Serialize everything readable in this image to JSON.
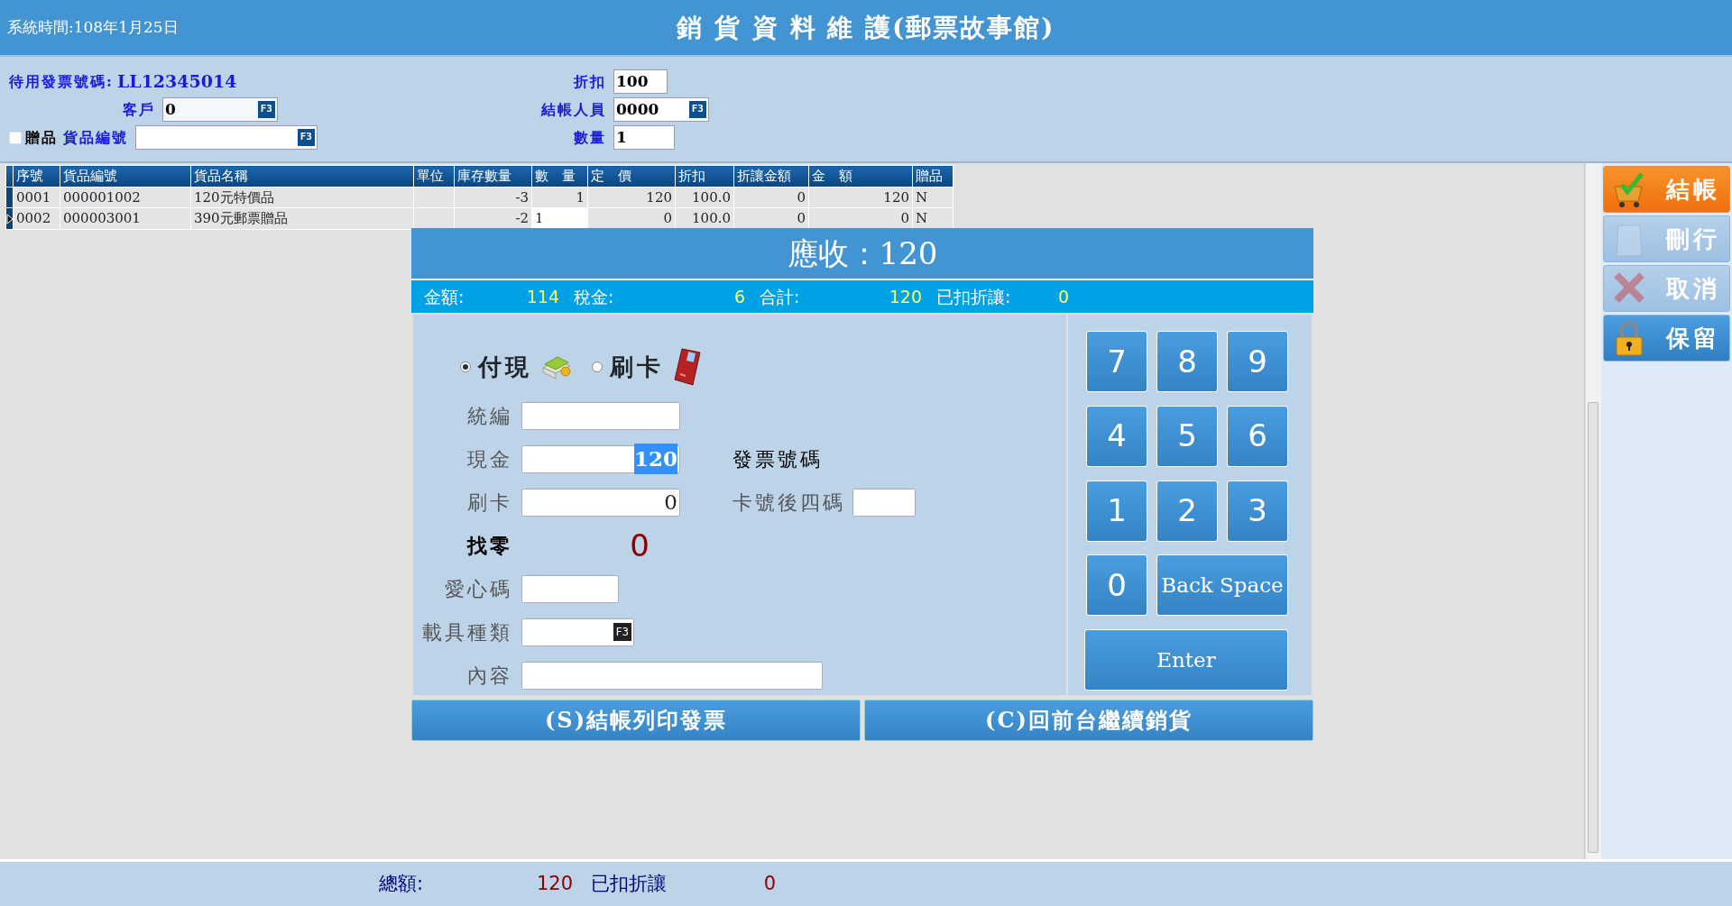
{
  "header": {
    "system_time": "系統時間:108年1月25日",
    "title": "銷 貨 資 料 維 護(郵票故事館)"
  },
  "form": {
    "invoice_label": "待用發票號碼:",
    "invoice_number": "LL12345014",
    "customer": {
      "label": "客戶",
      "value": "0",
      "key": "F3"
    },
    "gift": {
      "label": "贈品",
      "checked": false
    },
    "product_code": {
      "label": "貨品編號",
      "key": "F3"
    },
    "discount": {
      "label": "折扣",
      "value": "100"
    },
    "cashier": {
      "label": "結帳人員",
      "value": "0000",
      "key": "F3"
    },
    "quantity": {
      "label": "數量",
      "value": "1"
    }
  },
  "table": {
    "columns": [
      "序號",
      "貨品編號",
      "貨品名稱",
      "單位",
      "庫存數量",
      "數　量",
      "定　價",
      "折扣",
      "折讓金額",
      "金　額",
      "贈品"
    ],
    "rows": [
      {
        "current": false,
        "cells": [
          "0001",
          "000001002",
          "120元特價品",
          "",
          "-3",
          "1",
          "120",
          "100.0",
          "0",
          "120",
          "N"
        ]
      },
      {
        "current": true,
        "cells": [
          "0002",
          "000003001",
          "390元郵票贈品",
          "",
          "-2",
          "1",
          "0",
          "100.0",
          "0",
          "0",
          "N"
        ]
      }
    ]
  },
  "side_buttons": [
    {
      "kind": "checkout",
      "label": "結帳",
      "disabled": false,
      "highlighted": true
    },
    {
      "kind": "delete",
      "label": "刪行",
      "disabled": true,
      "highlighted": false
    },
    {
      "kind": "cancel",
      "label": "取消",
      "disabled": true,
      "highlighted": false
    },
    {
      "kind": "hold",
      "label": "保留",
      "disabled": false,
      "highlighted": false
    }
  ],
  "dialog": {
    "title": "應收：120",
    "summary": [
      {
        "label": "金額:",
        "value": "114"
      },
      {
        "label": "稅金:",
        "value": "6"
      },
      {
        "label": "合計:",
        "value": "120"
      },
      {
        "label": "已扣折讓:",
        "value": "0"
      }
    ],
    "payment": [
      {
        "kind": "cash",
        "label": "付現",
        "selected": true
      },
      {
        "kind": "card",
        "label": "刷卡",
        "selected": false
      }
    ],
    "fields": [
      {
        "kind": "input",
        "label": "統編"
      },
      {
        "kind": "input",
        "label": "現金",
        "value": "120",
        "highlighted": true,
        "side_label": "發票號碼"
      },
      {
        "kind": "input",
        "label": "刷卡",
        "value": "0",
        "highlighted": false,
        "side_label": "卡號後四碼",
        "side_field": true
      },
      {
        "kind": "change",
        "label": "找零",
        "value": "0"
      },
      {
        "kind": "short_input",
        "label": "愛心碼"
      },
      {
        "kind": "lookup",
        "label": "載具種類",
        "key": "F3"
      },
      {
        "kind": "long_input",
        "label": "內容"
      }
    ],
    "keypad": [
      "7",
      "8",
      "9",
      "4",
      "5",
      "6",
      "1",
      "2",
      "3",
      "0",
      "Back Space",
      "Enter"
    ],
    "actions": [
      "(S)結帳列印發票",
      "(C)回前台繼續銷貨"
    ]
  },
  "footer": {
    "total_label": "總額:",
    "total_value": "120",
    "discount_label": "已扣折讓",
    "discount_value": "0"
  }
}
